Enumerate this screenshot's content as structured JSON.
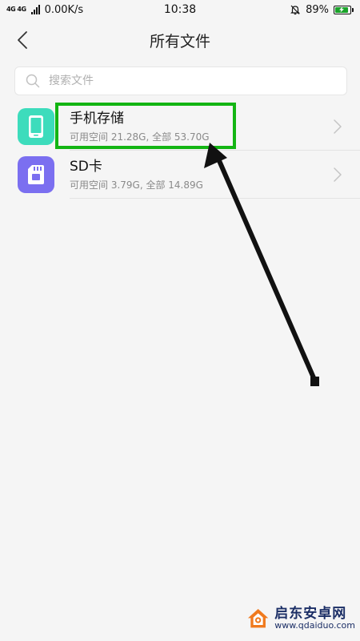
{
  "status_bar": {
    "network_label": "4G 4G",
    "speed": "0.00K/s",
    "time": "10:38",
    "battery_percent": "89%",
    "battery_level": 0.89
  },
  "header": {
    "title": "所有文件"
  },
  "search": {
    "placeholder": "搜索文件",
    "value": ""
  },
  "storage": [
    {
      "title": "手机存储",
      "subtitle": "可用空间 21.28G, 全部 53.70G",
      "icon": "phone-icon",
      "icon_color": "#3ddcbc"
    },
    {
      "title": "SD卡",
      "subtitle": "可用空间 3.79G, 全部 14.89G",
      "icon": "sd-card-icon",
      "icon_color": "#7b6ff0"
    }
  ],
  "colors": {
    "highlight": "#13b513",
    "arrow": "#111111",
    "watermark_orange": "#f07a1e",
    "watermark_navy": "#1c2f66"
  },
  "watermark": {
    "name": "启东安卓网",
    "url": "www.qdaiduo.com"
  }
}
